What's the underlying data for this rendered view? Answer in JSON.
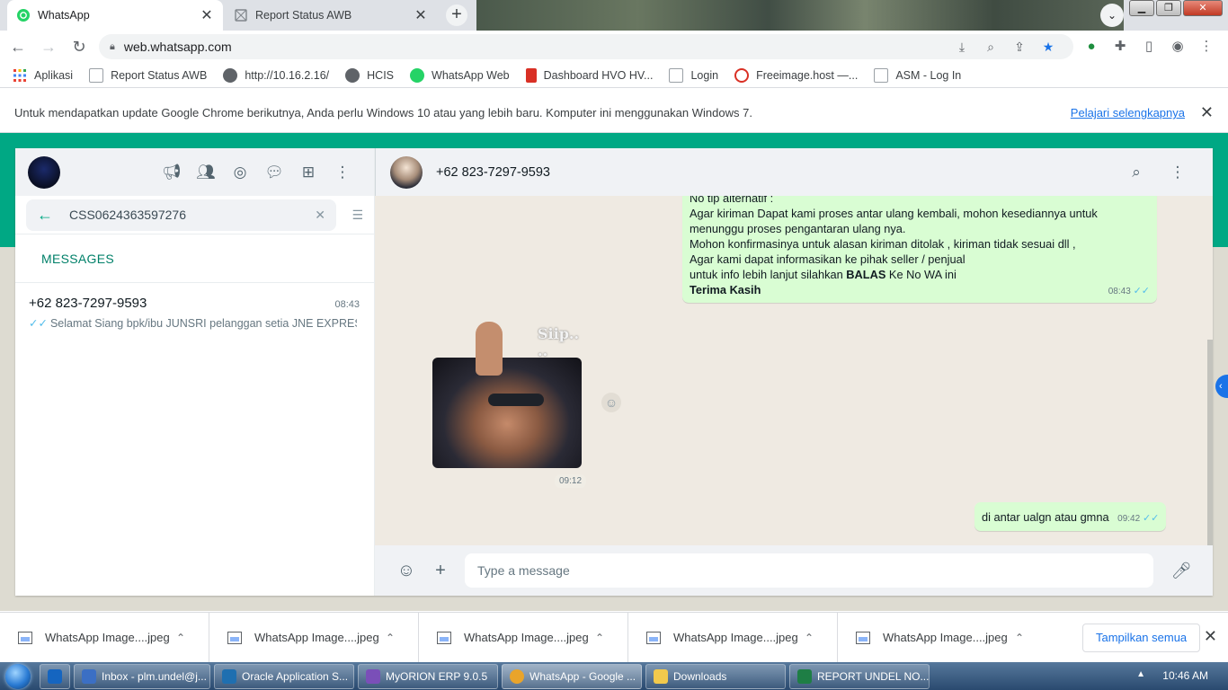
{
  "browser": {
    "tabs": [
      {
        "title": "WhatsApp",
        "icon": "whatsapp-icon"
      },
      {
        "title": "Report Status AWB",
        "icon": "page-icon"
      }
    ],
    "url": "web.whatsapp.com",
    "bookmarks": [
      {
        "label": "Aplikasi",
        "icon": "apps-grid-icon"
      },
      {
        "label": "Report Status AWB",
        "icon": "page-icon"
      },
      {
        "label": "http://10.16.2.16/",
        "icon": "globe-icon"
      },
      {
        "label": "HCIS",
        "icon": "globe-icon"
      },
      {
        "label": "WhatsApp Web",
        "icon": "whatsapp-icon"
      },
      {
        "label": "Dashboard HVO HV...",
        "icon": "dashboard-icon"
      },
      {
        "label": "Login",
        "icon": "page-icon"
      },
      {
        "label": "Freeimage.host —...",
        "icon": "freeimage-icon"
      },
      {
        "label": "ASM - Log In",
        "icon": "page-icon"
      }
    ],
    "infobar": {
      "text": "Untuk mendapatkan update Google Chrome berikutnya, Anda perlu Windows 10 atau yang lebih baru. Komputer ini menggunakan Windows 7.",
      "link": "Pelajari selengkapnya"
    }
  },
  "whatsapp": {
    "search": {
      "value": "CSS0624363597276"
    },
    "section_label": "MESSAGES",
    "results": [
      {
        "name": "+62 823-7297-9593",
        "time": "08:43",
        "preview": "Selamat Siang   bpk/ibu JUNSRI pelanggan setia JNE EXPRES..."
      }
    ],
    "chat": {
      "contact": "+62 823-7297-9593",
      "messages": {
        "out1": {
          "lines": [
            "No tlp alternatif :",
            "Agar kiriman Dapat kami proses antar ulang kembali, mohon kesediannya untuk",
            "menunggu proses pengantaran ulang nya.",
            "Mohon konfirmasinya untuk alasan kiriman ditolak , kiriman tidak sesuai dll ,",
            "Agar kami dapat informasikan ke pihak seller / penjual"
          ],
          "line6_pre": "untuk info lebih lanjut silahkan ",
          "line6_bold": "BALAS",
          "line6_post": " Ke No WA ini",
          "closing": "Terima Kasih",
          "time": "08:43"
        },
        "sticker": {
          "caption": "Siip.. ..",
          "time": "09:12"
        },
        "out2": {
          "text": "di antar ualgn atau gmna",
          "time": "09:42"
        }
      },
      "composer_placeholder": "Type a message"
    }
  },
  "downloads": {
    "items": [
      "WhatsApp Image....jpeg",
      "WhatsApp Image....jpeg",
      "WhatsApp Image....jpeg",
      "WhatsApp Image....jpeg",
      "WhatsApp Image....jpeg"
    ],
    "show_all": "Tampilkan semua"
  },
  "taskbar": {
    "items": [
      {
        "label": "Inbox - plm.undel@j...",
        "color": "#3b6fc4"
      },
      {
        "label": "Oracle Application S...",
        "color": "#1f6fb0"
      },
      {
        "label": "MyORION ERP 9.0.5",
        "color": "#7a4fb8"
      },
      {
        "label": "WhatsApp - Google ...",
        "color": "#e9a42b"
      },
      {
        "label": "Downloads",
        "color": "#f2c94c"
      },
      {
        "label": "REPORT UNDEL NO...",
        "color": "#1e7e45"
      }
    ],
    "clock": "10:46 AM"
  },
  "colors": {
    "wa_green": "#00a884",
    "bubble_out": "#d9fdd3",
    "read_ticks": "#53bdeb",
    "chrome_blue": "#1a73e8"
  }
}
